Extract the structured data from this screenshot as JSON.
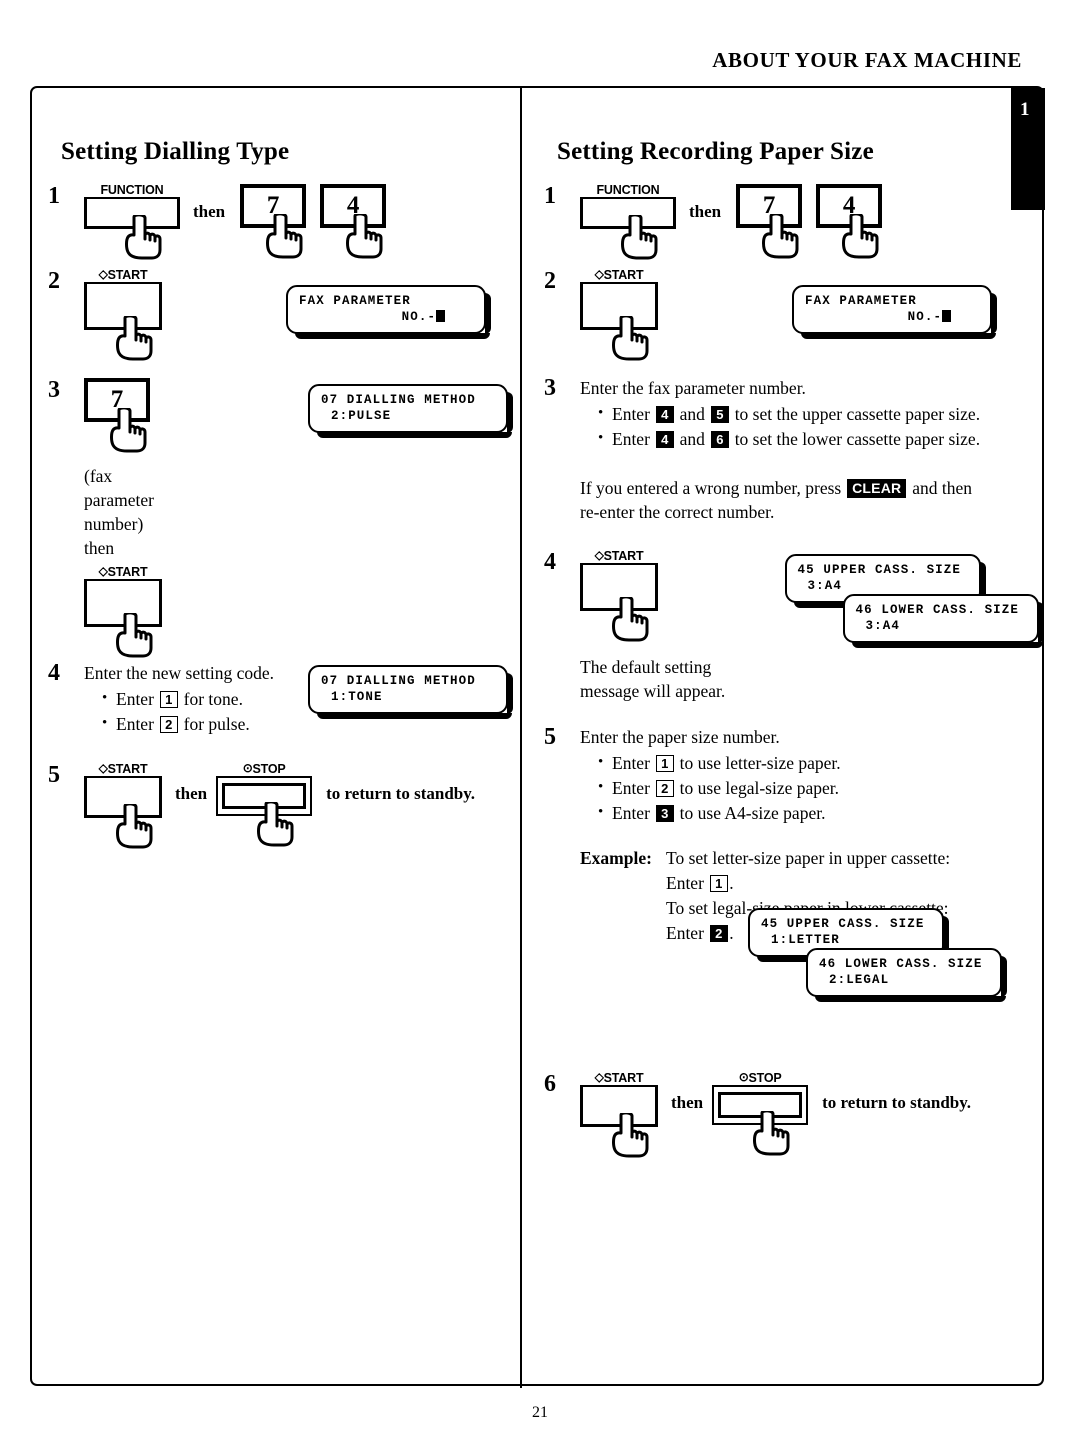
{
  "header": {
    "running_title": "ABOUT YOUR FAX MACHINE"
  },
  "tab": {
    "number": "1"
  },
  "page": {
    "number": "21"
  },
  "common": {
    "then": "then",
    "function_key": "FUNCTION",
    "start_key": "START",
    "stop_key": "STOP",
    "start_symbol": "◇",
    "stop_symbol": "⊙",
    "key_7": "7",
    "key_4": "4",
    "return_standby": "to return to standby."
  },
  "left": {
    "title": "Setting Dialling Type",
    "steps": {
      "s1": {
        "num": "1"
      },
      "s2": {
        "num": "2",
        "lcd": {
          "line1": "FAX PARAMETER",
          "line2": "NO."
        }
      },
      "s3": {
        "num": "3",
        "key": "7",
        "note": "(fax parameter number) then",
        "lcd": {
          "line1": "07 DIALLING METHOD",
          "line2": "2:PULSE"
        }
      },
      "s4": {
        "num": "4",
        "intro": "Enter the new setting code.",
        "bullets": [
          {
            "pre": "Enter",
            "key": "1",
            "post": "for tone."
          },
          {
            "pre": "Enter",
            "key": "2",
            "post": "for pulse."
          }
        ],
        "lcd": {
          "line1": "07 DIALLING METHOD",
          "line2": "1:TONE"
        }
      },
      "s5": {
        "num": "5"
      }
    }
  },
  "right": {
    "title": "Setting Recording Paper Size",
    "steps": {
      "s1": {
        "num": "1"
      },
      "s2": {
        "num": "2",
        "lcd": {
          "line1": "FAX PARAMETER",
          "line2": "NO."
        }
      },
      "s3": {
        "num": "3",
        "intro": "Enter the fax parameter number.",
        "bullets": [
          {
            "pre": "Enter",
            "key1": "4",
            "mid": "and",
            "key2": "5",
            "post": "to set the upper cassette paper size."
          },
          {
            "pre": "Enter",
            "key1": "4",
            "mid": "and",
            "key2": "6",
            "post": "to set the lower cassette paper size."
          }
        ],
        "note_pre": "If you entered a wrong number, press",
        "note_key": "CLEAR",
        "note_post": "and then",
        "note_line2": "re-enter the correct number."
      },
      "s4": {
        "num": "4",
        "caption_line1": "The default setting",
        "caption_line2": "message will appear.",
        "lcd_upper": {
          "line1": "45 UPPER CASS. SIZE",
          "line2": "3:A4"
        },
        "lcd_lower": {
          "line1": "46 LOWER CASS. SIZE",
          "line2": "3:A4"
        }
      },
      "s5": {
        "num": "5",
        "intro": "Enter the paper size number.",
        "bullets": [
          {
            "pre": "Enter",
            "key": "1",
            "post": "to use letter-size paper."
          },
          {
            "pre": "Enter",
            "key": "2",
            "post": "to use legal-size paper."
          },
          {
            "pre": "Enter",
            "key": "3",
            "post": "to use A4-size paper."
          }
        ],
        "example": {
          "label": "Example:",
          "line1": "To set letter-size paper in upper cassette:",
          "line2_pre": "Enter",
          "line2_key": "1",
          "line2_post": ".",
          "line3": "To set legal-size paper in lower cassette:",
          "line4_pre": "Enter",
          "line4_key": "2",
          "line4_post": ".",
          "lcd_upper": {
            "line1": "45 UPPER CASS. SIZE",
            "line2": "1:LETTER"
          },
          "lcd_lower": {
            "line1": "46 LOWER CASS. SIZE",
            "line2": "2:LEGAL"
          }
        }
      },
      "s6": {
        "num": "6"
      }
    }
  }
}
